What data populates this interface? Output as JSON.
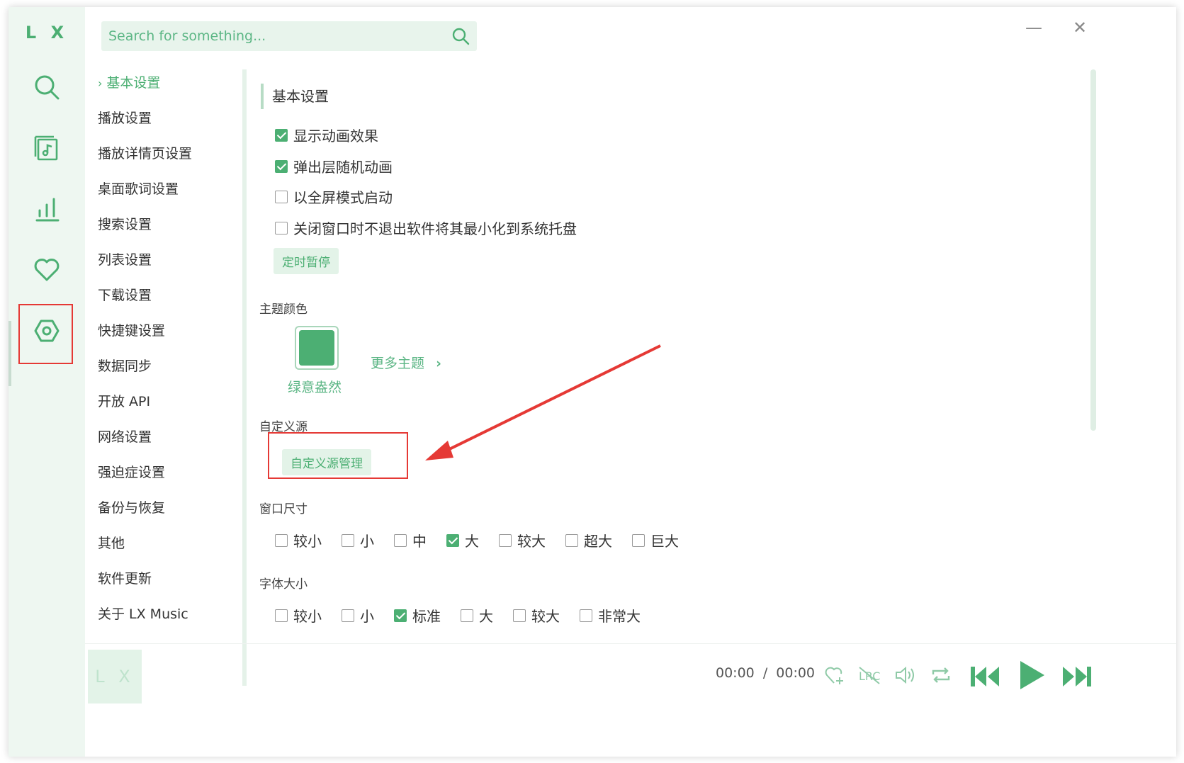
{
  "app": {
    "logo": "L X",
    "player_logo": "L X"
  },
  "search": {
    "placeholder": "Search for something..."
  },
  "window_controls": {
    "minimize": "—",
    "close": "✕"
  },
  "rail_icons": [
    "search-icon",
    "music-library-icon",
    "leaderboard-icon",
    "heart-icon",
    "settings-icon"
  ],
  "nav": {
    "items": [
      {
        "label": "基本设置",
        "active": true
      },
      {
        "label": "播放设置"
      },
      {
        "label": "播放详情页设置"
      },
      {
        "label": "桌面歌词设置"
      },
      {
        "label": "搜索设置"
      },
      {
        "label": "列表设置"
      },
      {
        "label": "下载设置"
      },
      {
        "label": "快捷键设置"
      },
      {
        "label": "数据同步"
      },
      {
        "label": "开放 API"
      },
      {
        "label": "网络设置"
      },
      {
        "label": "强迫症设置"
      },
      {
        "label": "备份与恢复"
      },
      {
        "label": "其他"
      },
      {
        "label": "软件更新"
      },
      {
        "label": "关于 LX Music"
      }
    ]
  },
  "content": {
    "section_title": "基本设置",
    "checkboxes": [
      {
        "label": "显示动画效果",
        "checked": true
      },
      {
        "label": "弹出层随机动画",
        "checked": true
      },
      {
        "label": "以全屏模式启动",
        "checked": false
      },
      {
        "label": "关闭窗口时不退出软件将其最小化到系统托盘",
        "checked": false
      }
    ],
    "timer_button": "定时暂停",
    "theme": {
      "label": "主题颜色",
      "current": "绿意盎然",
      "more": "更多主题",
      "color": "#4caf73"
    },
    "custom_source": {
      "label": "自定义源",
      "button": "自定义源管理"
    },
    "window_size": {
      "label": "窗口尺寸",
      "options": [
        {
          "label": "较小",
          "checked": false
        },
        {
          "label": "小",
          "checked": false
        },
        {
          "label": "中",
          "checked": false
        },
        {
          "label": "大",
          "checked": true
        },
        {
          "label": "较大",
          "checked": false
        },
        {
          "label": "超大",
          "checked": false
        },
        {
          "label": "巨大",
          "checked": false
        }
      ]
    },
    "font_size": {
      "label": "字体大小",
      "options": [
        {
          "label": "较小",
          "checked": false
        },
        {
          "label": "小",
          "checked": false
        },
        {
          "label": "标准",
          "checked": true
        },
        {
          "label": "大",
          "checked": false
        },
        {
          "label": "较大",
          "checked": false
        },
        {
          "label": "非常大",
          "checked": false
        }
      ]
    }
  },
  "player": {
    "time_current": "00:00",
    "time_sep": "/",
    "time_total": "00:00",
    "controls": [
      "heart-add-icon",
      "lyric-icon",
      "volume-icon",
      "repeat-icon",
      "previous-icon",
      "play-icon",
      "next-icon"
    ]
  },
  "colors": {
    "accent": "#4caf73",
    "rail_bg": "#eef7f1",
    "highlight_box": "#e53935"
  }
}
